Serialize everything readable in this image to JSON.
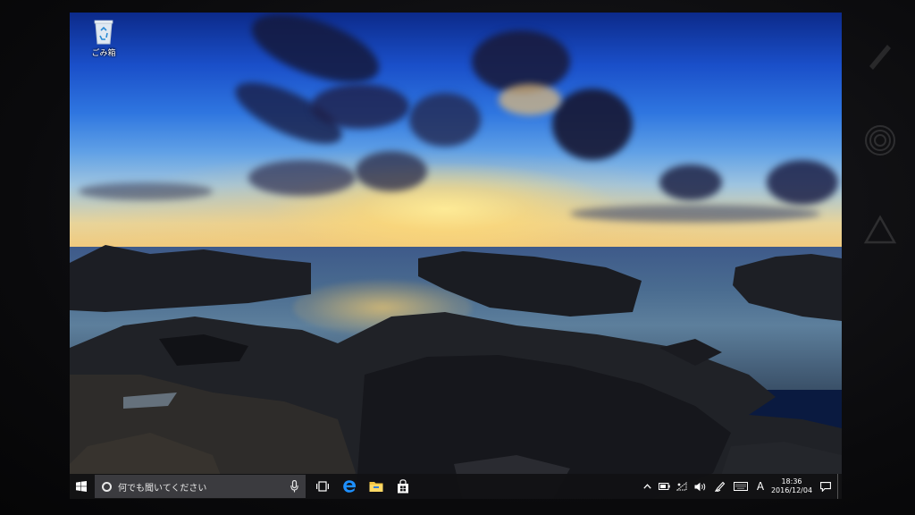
{
  "desktop": {
    "icons": [
      {
        "label": "ごみ箱",
        "icon": "recycle-bin-icon"
      }
    ]
  },
  "taskbar": {
    "start_icon": "windows-logo-icon",
    "search": {
      "placeholder": "何でも聞いてください",
      "icon": "cortana-circle-icon",
      "mic_icon": "microphone-icon"
    },
    "pinned": [
      {
        "name": "task-view",
        "icon": "task-view-icon"
      },
      {
        "name": "edge",
        "icon": "edge-icon",
        "color": "#1e90ff"
      },
      {
        "name": "file-explorer",
        "icon": "folder-icon",
        "color": "#f4c542"
      },
      {
        "name": "store",
        "icon": "store-bag-icon"
      }
    ],
    "tray": {
      "icons": [
        "chevron-up-icon",
        "battery-icon",
        "network-icon",
        "volume-icon",
        "pen-icon",
        "keyboard-icon"
      ],
      "ime": "A",
      "time": "18:36",
      "date": "2016/12/04",
      "notification_icon": "action-center-icon"
    }
  },
  "colors": {
    "taskbar_bg": "#121214",
    "search_bg": "#3b3b3f"
  }
}
